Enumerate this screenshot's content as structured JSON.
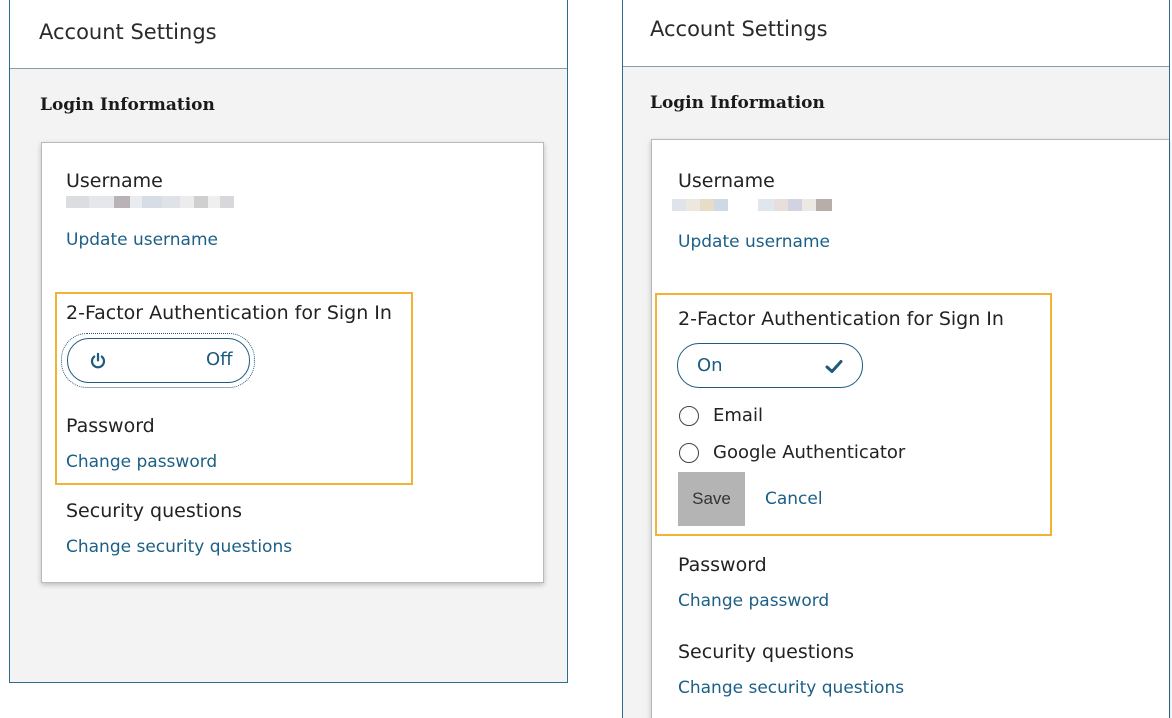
{
  "left": {
    "header_title": "Account Settings",
    "section_title": "Login Information",
    "username_label": "Username",
    "update_username": "Update username",
    "tfa_label": "2-Factor Authentication for Sign In",
    "toggle_state": "Off",
    "password_label": "Password",
    "change_password": "Change password",
    "security_label": "Security questions",
    "change_security": "Change security questions"
  },
  "right": {
    "header_title": "Account Settings",
    "section_title": "Login Information",
    "username_label": "Username",
    "update_username": "Update username",
    "tfa_label": "2-Factor Authentication for Sign In",
    "toggle_state": "On",
    "option_email": "Email",
    "option_google": "Google Authenticator",
    "save": "Save",
    "cancel": "Cancel",
    "password_label": "Password",
    "change_password": "Change password",
    "security_label": "Security questions",
    "change_security": "Change security questions"
  },
  "colors": {
    "accent_link": "#1c5f86",
    "panel_border": "#2a6f8f",
    "highlight": "#f2b233",
    "save_bg": "#b4b4b4"
  },
  "icons": {
    "power": "power-icon",
    "check": "checkmark-icon"
  }
}
